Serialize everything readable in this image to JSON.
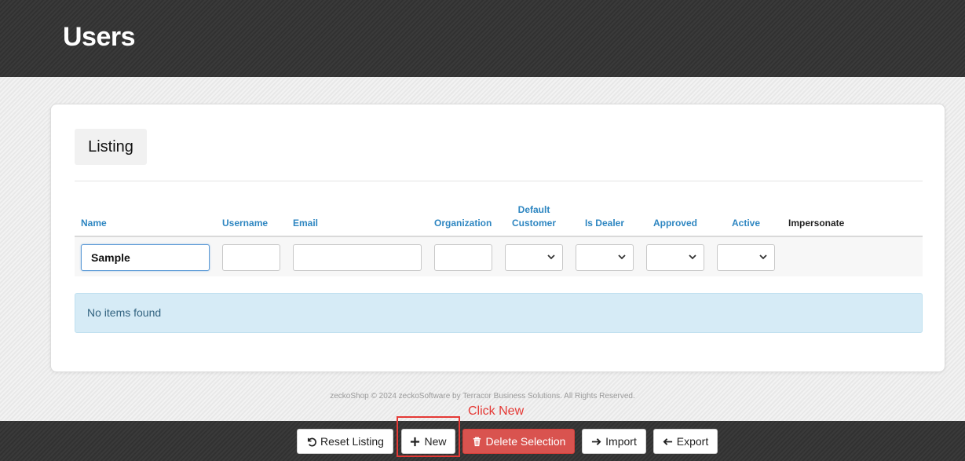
{
  "header": {
    "title": "Users"
  },
  "card": {
    "title": "Listing",
    "columns": {
      "name": "Name",
      "username": "Username",
      "email": "Email",
      "organization": "Organization",
      "default_customer": "Default Customer",
      "is_dealer": "Is Dealer",
      "approved": "Approved",
      "active": "Active",
      "impersonate": "Impersonate"
    },
    "filters": {
      "name_value": "Sample",
      "username_value": "",
      "email_value": "",
      "organization_value": ""
    },
    "empty_message": "No items found"
  },
  "footer": {
    "copyright": "zeckoShop © 2024 zeckoSoftware by Terracor Business Solutions. All Rights Reserved."
  },
  "annotation": {
    "text": "Click New",
    "color": "#e53935"
  },
  "toolbar": {
    "reset_label": "Reset Listing",
    "new_label": "New",
    "delete_label": "Delete Selection",
    "import_label": "Import",
    "export_label": "Export"
  },
  "icons": {
    "reset": "undo-icon",
    "new": "plus-icon",
    "delete": "trash-icon",
    "import": "arrow-right-icon",
    "export": "arrow-left-icon"
  },
  "colors": {
    "header_bg": "#343434",
    "link_blue": "#2e86c1",
    "alert_bg": "#d6ebf6",
    "danger": "#d9534f"
  }
}
